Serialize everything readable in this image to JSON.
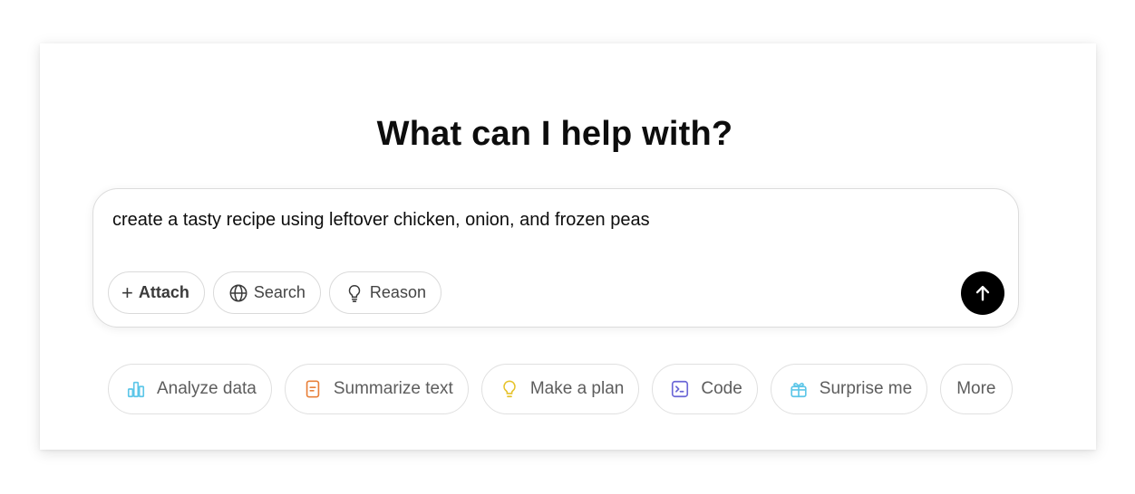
{
  "heading": "What can I help with?",
  "composer": {
    "prompt": "create a tasty recipe using leftover chicken, onion, and frozen peas",
    "tools": {
      "attach": "Attach",
      "search": "Search",
      "reason": "Reason"
    },
    "send_icon": "arrow-up-icon"
  },
  "suggestions": [
    {
      "label": "Analyze data",
      "icon": "bar-chart-icon",
      "color": "#5cc6e8"
    },
    {
      "label": "Summarize text",
      "icon": "document-icon",
      "color": "#e8803a"
    },
    {
      "label": "Make a plan",
      "icon": "lightbulb-icon",
      "color": "#e6c229"
    },
    {
      "label": "Code",
      "icon": "terminal-icon",
      "color": "#6a66d6"
    },
    {
      "label": "Surprise me",
      "icon": "gift-icon",
      "color": "#5cc6e8"
    },
    {
      "label": "More"
    }
  ],
  "colors": {
    "send_button": "#000000",
    "chip_border": "#e0e0e0",
    "text": "#0d0d0d"
  }
}
